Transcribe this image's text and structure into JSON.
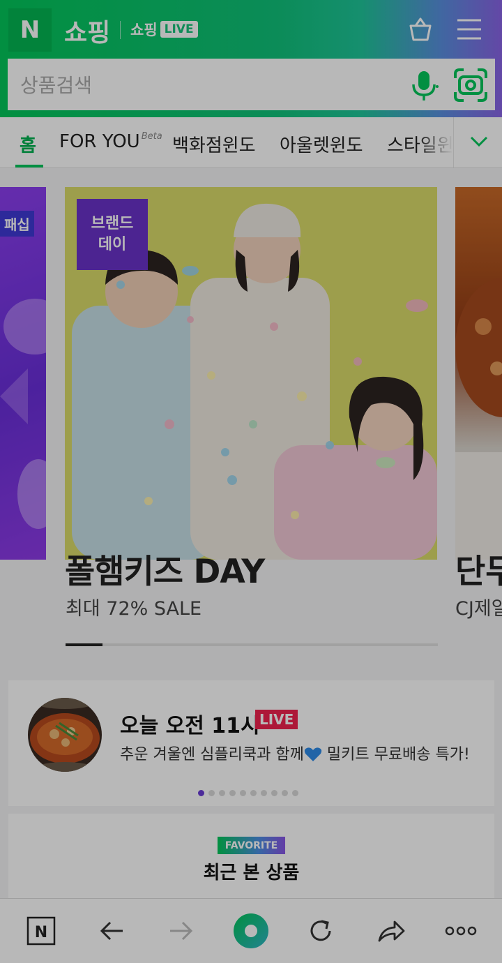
{
  "header": {
    "logo": "N",
    "title": "쇼핑",
    "live_text": "쇼핑",
    "live_badge": "LIVE",
    "search_placeholder": "상품검색",
    "icons": [
      "basket-icon",
      "menu-icon",
      "mic-icon",
      "lens-icon"
    ]
  },
  "tabs": {
    "items": [
      "홈",
      "FOR YOU",
      "백화점윈도",
      "아울렛윈도",
      "스타일윈"
    ],
    "beta": "Beta",
    "active": 0
  },
  "carousel": {
    "left_card": {
      "tag": "패십"
    },
    "main_card": {
      "brand_tag": "브랜드\n데이",
      "title": "폴햄키즈 DAY",
      "subtitle": "최대 72% SALE"
    },
    "right_card": {
      "title": "단무",
      "subtitle": "CJ제일"
    },
    "progress_fraction": 0.1
  },
  "live": {
    "title": "오늘 오전 11시",
    "badge": "LIVE",
    "desc_before": "추운 겨울엔 심플리쿡과 함께",
    "desc_after": " 밀키트 무료배송 특가!",
    "dots_total": 10,
    "dots_active": 0
  },
  "favorite": {
    "badge": "FAVORITE",
    "title": "최근 본 상품"
  },
  "bottombar": {
    "n_button": "N",
    "icons": [
      "home-n-icon",
      "back-arrow-icon",
      "forward-arrow-icon",
      "green-circle-icon",
      "refresh-icon",
      "share-icon",
      "more-icon"
    ]
  },
  "colors": {
    "naver_green": "#03c75a",
    "live_red": "#f0224e",
    "purple": "#6a33c9"
  }
}
